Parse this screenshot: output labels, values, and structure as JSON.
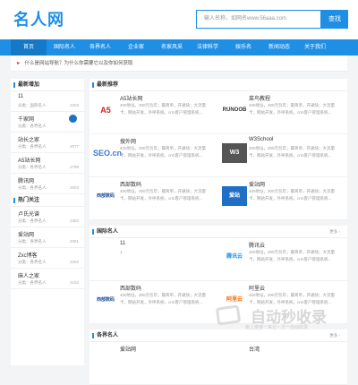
{
  "header": {
    "logo": "名人网",
    "search_placeholder": "输入名称，如网名www.56aaa.com",
    "search_label": "查找"
  },
  "nav": [
    "首页",
    "国际名人",
    "各界名人",
    "企业家",
    "名家风采",
    "法律科学",
    "娱乐名",
    "新闻动态",
    "关于我们"
  ],
  "notice": "什么是网站导航？为什么你需要它以及你如何获取",
  "sidebar": {
    "title1": "最新增加",
    "rows1": [
      {
        "name": "11",
        "cat": "分类：国际名人",
        "num": "2203"
      },
      {
        "name": "千家网",
        "cat": "分类：各界名人",
        "num": "2095"
      },
      {
        "name": "站长之家",
        "cat": "分类：各界名人",
        "num": "2077"
      },
      {
        "name": "A5站长网",
        "cat": "分类：各界名人",
        "num": "2799"
      },
      {
        "name": "腾讯网",
        "cat": "分类：各界名人",
        "num": "2003"
      }
    ],
    "title2": "热门关注",
    "rows2": [
      {
        "name": "卢氏光谱",
        "cat": "分类：各界名人",
        "num": "2392"
      },
      {
        "name": "爱站网",
        "cat": "分类：各界名人",
        "num": "2081"
      },
      {
        "name": "Zxc博客",
        "cat": "分类：各界名人",
        "num": "2392"
      },
      {
        "name": "麻人之家",
        "cat": "分类：各界名人",
        "num": "2152"
      }
    ]
  },
  "featured": {
    "title": "最新推荐",
    "cards": [
      {
        "name": "A5站长网",
        "logo": "A5",
        "desc": "400地址，300元包年；最简单，开通快；大流量卡，网站开发，外呼系统，crm客户管理系统..."
      },
      {
        "name": "菜鸟教程",
        "logo": "RUNOOB",
        "desc": "400地址，300元包年；最简单，开通快；大流量卡，网站开发，外呼系统，crm客户管理系统..."
      },
      {
        "name": "搜外网",
        "logo": "SEO.cn",
        "desc": "400地址，300元包年；最简单，开通快；大流量卡，网站开发，外呼系统，crm客户管理系统..."
      },
      {
        "name": "W3School",
        "logo": "W3",
        "desc": "400地址，300元包年；最简单，开通快；大流量卡，网站开发，外呼系统，crm客户管理系统..."
      },
      {
        "name": "西部数码",
        "logo": "西部数码",
        "desc": "400地址，300元包年；最简单，开通快；大流量卡，网站开发，外呼系统，crm客户管理系统..."
      },
      {
        "name": "爱站网",
        "logo": "爱站",
        "desc": "400地址，300元包年；最简单，开通快；大流量卡，网站开发，外呼系统，crm客户管理系统..."
      }
    ]
  },
  "intl": {
    "title": "国际名人",
    "more": "更多 ›",
    "cards": [
      {
        "name": "11",
        "logo": "",
        "desc": "1"
      },
      {
        "name": "腾讯云",
        "logo": "腾讯云",
        "desc": "400地址，300元包年；最简单，开通快；大流量卡，网站开发，外呼系统，crm客户管理系统..."
      },
      {
        "name": "西部数码",
        "logo": "西部数码",
        "desc": "400地址，300元包年；最简单，开通快；大流量卡，网站开发，外呼系统，crm客户管理系统..."
      },
      {
        "name": "阿里云",
        "logo": "阿里云",
        "desc": "400地址，300元包年；最简单，开通快；大流量卡，网站开发，外呼系统，crm客户管理系统..."
      }
    ]
  },
  "sectors": {
    "title": "各界名人",
    "more": "更多 ›",
    "cards": [
      {
        "name": "爱站网"
      },
      {
        "name": "台湾"
      }
    ]
  },
  "watermark": {
    "title": "自动秒收录",
    "sub": "做上链接一来访一次一自动收录"
  }
}
